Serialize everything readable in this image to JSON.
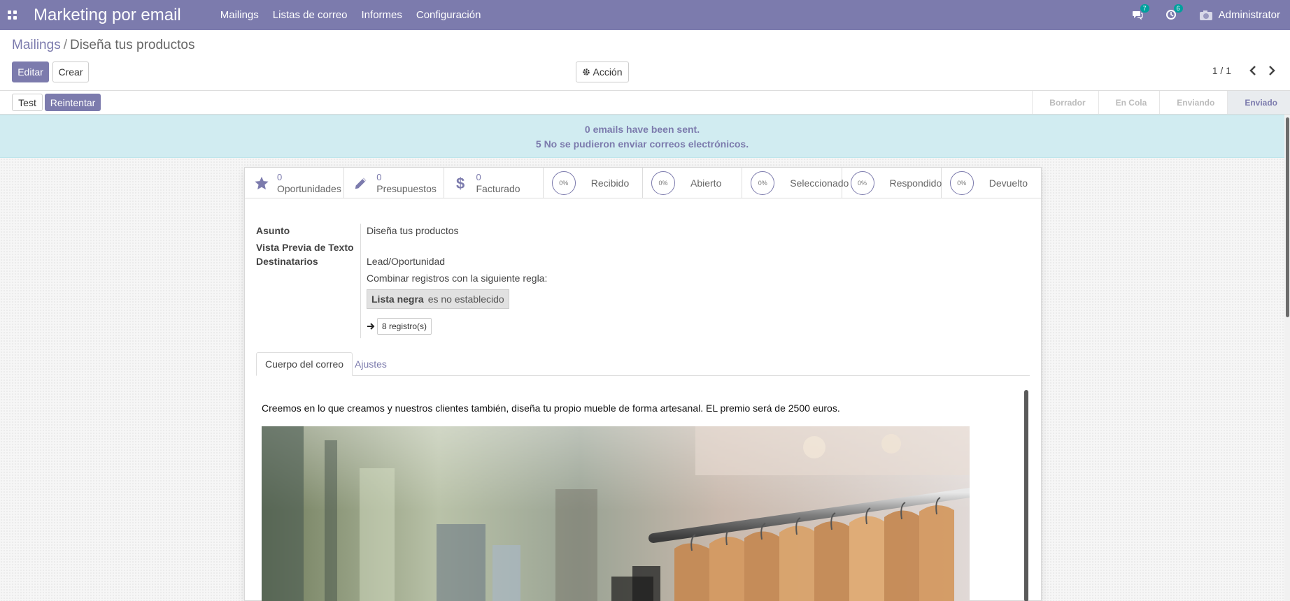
{
  "app": {
    "title": "Marketing por email",
    "menu": [
      "Mailings",
      "Listas de correo",
      "Informes",
      "Configuración"
    ],
    "messages_badge": "7",
    "activities_badge": "6",
    "user": "Administrator"
  },
  "breadcrumb": {
    "parent": "Mailings",
    "separator": "/",
    "current": "Diseña tus productos"
  },
  "buttons": {
    "edit": "Editar",
    "create": "Crear",
    "action": "Acción",
    "test": "Test",
    "retry": "Reintentar"
  },
  "pager": "1 / 1",
  "stages": [
    "Borrador",
    "En Cola",
    "Enviando",
    "Enviado"
  ],
  "active_stage": "Enviado",
  "alert": {
    "line1": "0  emails have been sent.",
    "line2": "5  No se pudieron enviar correos electrónicos."
  },
  "smart_buttons": [
    {
      "value": "0",
      "label": "Oportunidades",
      "icon": "star-icon"
    },
    {
      "value": "0",
      "label": "Presupuestos",
      "icon": "pencil-icon"
    },
    {
      "value": "0",
      "label": "Facturado",
      "icon": "dollar-icon"
    }
  ],
  "stat_buttons": [
    {
      "value": "0%",
      "label": "Recibido"
    },
    {
      "value": "0%",
      "label": "Abierto"
    },
    {
      "value": "0%",
      "label": "Seleccionado"
    },
    {
      "value": "0%",
      "label": "Respondido"
    },
    {
      "value": "0%",
      "label": "Devuelto"
    }
  ],
  "form": {
    "subject_label": "Asunto",
    "subject_value": "Diseña tus productos",
    "preview_label": "Vista Previa de Texto",
    "recipients_label": "Destinatarios",
    "recipients_value": "Lead/Oportunidad",
    "rule_text": "Combinar registros con la siguiente regla:",
    "domain_field": "Lista negra",
    "domain_rule": "es no establecido",
    "records": "8 registro(s)"
  },
  "tabs": [
    "Cuerpo del correo",
    "Ajustes"
  ],
  "body_text": "Creemos en lo que creamos y nuestros clientes también, diseña tu propio mueble de forma artesanal. EL premio será de 2500 euros.",
  "colors": {
    "brand": "#7c7bad",
    "alert_bg": "#d1ecf1",
    "badge": "#00a09d"
  }
}
